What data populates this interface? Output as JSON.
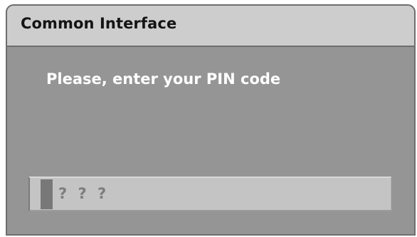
{
  "dialog": {
    "title": "Common Interface",
    "prompt": "Please, enter your PIN code",
    "pin_field": {
      "value": "? ? ?"
    }
  }
}
